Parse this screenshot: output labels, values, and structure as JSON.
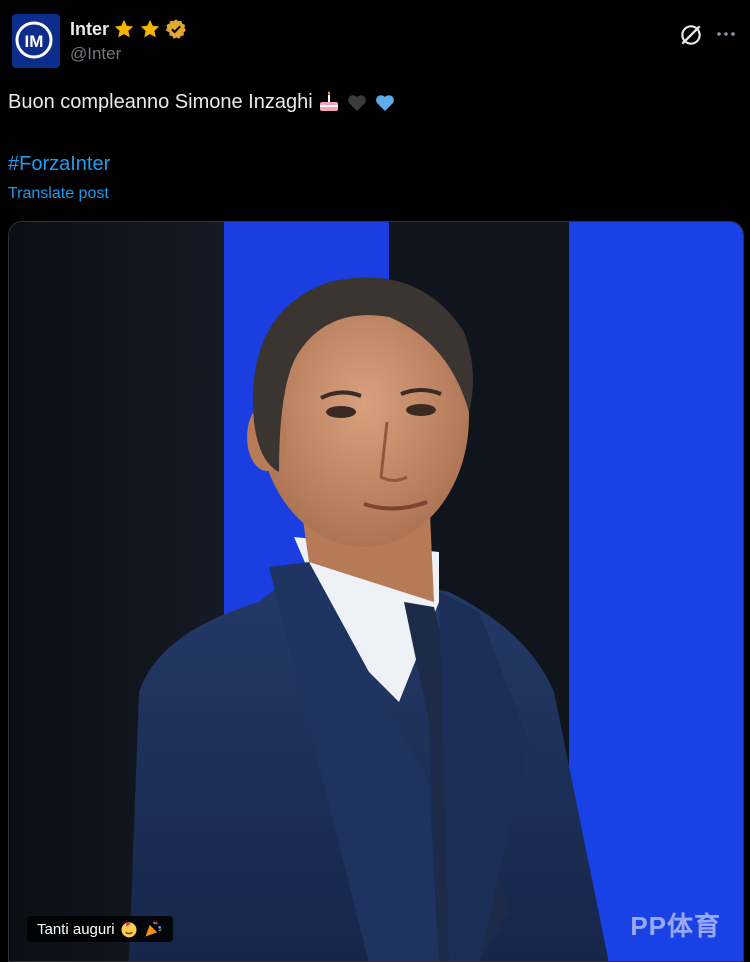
{
  "post": {
    "author_name": "Inter",
    "author_handle": "@Inter",
    "text": "Buon compleanno Simone Inzaghi",
    "hashtag": "#ForzaInter",
    "translate_label": "Translate post"
  },
  "media": {
    "caption_badge": "Tanti auguri",
    "watermark": "PP体育"
  },
  "icons": {
    "avatar": "inter-logo-icon",
    "badges": [
      "star-icon",
      "star-icon",
      "verified-icon"
    ],
    "emojis_text": [
      "birthday-cake-emoji",
      "black-heart-emoji",
      "blue-heart-emoji"
    ],
    "emojis_badge": [
      "party-face-emoji",
      "party-popper-emoji"
    ]
  },
  "colors": {
    "background": "#000000",
    "link": "#1d9bf0",
    "inter_blue": "#1a3ee0",
    "star": "#f5b400",
    "verified": "#e0a82e"
  }
}
